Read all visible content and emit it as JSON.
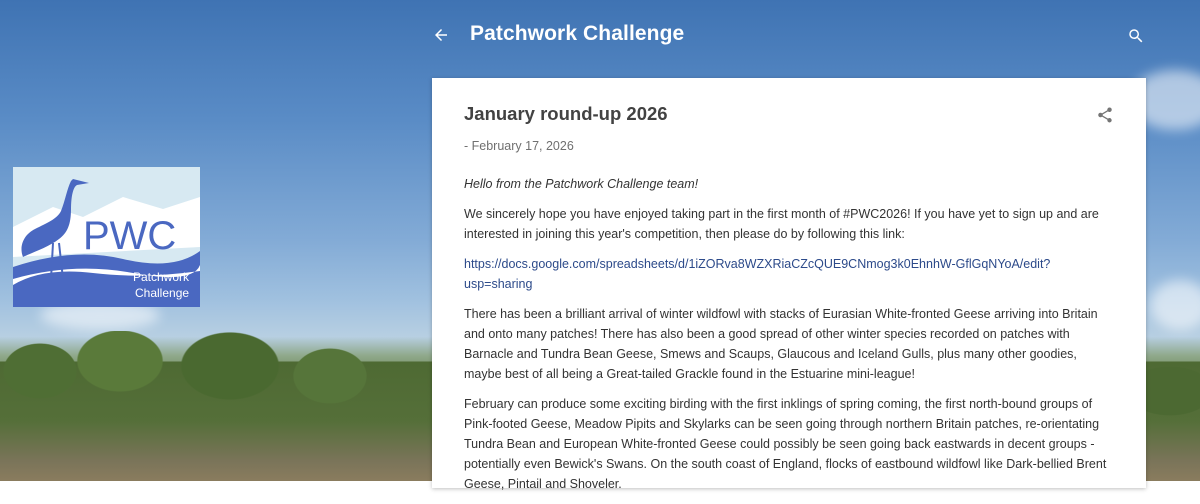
{
  "header": {
    "blog_title": "Patchwork Challenge",
    "back_icon": "arrow-left-icon",
    "search_icon": "search-icon"
  },
  "logo": {
    "alt": "PWC Patchwork Challenge",
    "main_text": "PWC",
    "line1": "Patchwork",
    "line2": "Challenge",
    "colors": {
      "blue": "#4a68c1",
      "light_blue": "#cfe3ee"
    }
  },
  "post": {
    "title": "January round-up 2026",
    "date": "- February 17, 2026",
    "share_icon": "share-icon",
    "paragraphs": {
      "intro": "Hello from the Patchwork Challenge team!",
      "p1": "We sincerely hope you have enjoyed taking part in the first month of #PWC2026! If you have yet to sign up and are interested in joining this year's competition, then please do by following this link:",
      "link": "https://docs.google.com/spreadsheets/d/1iZORva8WZXRiaCZcQUE9CNmog3k0EhnhW-GflGqNYoA/edit?usp=sharing",
      "p2": "There has been a brilliant arrival of winter wildfowl with stacks of Eurasian White-fronted Geese arriving into Britain and onto many patches! There has also been a good spread of other winter species recorded on patches with Barnacle and Tundra Bean Geese, Smews and Scaups, Glaucous and Iceland Gulls, plus many other goodies, maybe best of all being a Great-tailed Grackle found in the Estuarine mini-league!",
      "p3": "February can produce some exciting birding with the first inklings of spring coming, the first north-bound groups of Pink-footed Geese, Meadow Pipits and Skylarks can be seen going through northern Britain patches, re-orientating Tundra Bean and European White-fronted Geese could possibly be seen going back eastwards in decent groups - potentially even Bewick's Swans. On the south coast of England, flocks of eastbound wildfowl like Dark-bellied Brent Geese, Pintail and Shoveler."
    }
  },
  "colors": {
    "link": "#2c4a8a",
    "title_text": "#424242",
    "header_text": "#ffffff"
  }
}
